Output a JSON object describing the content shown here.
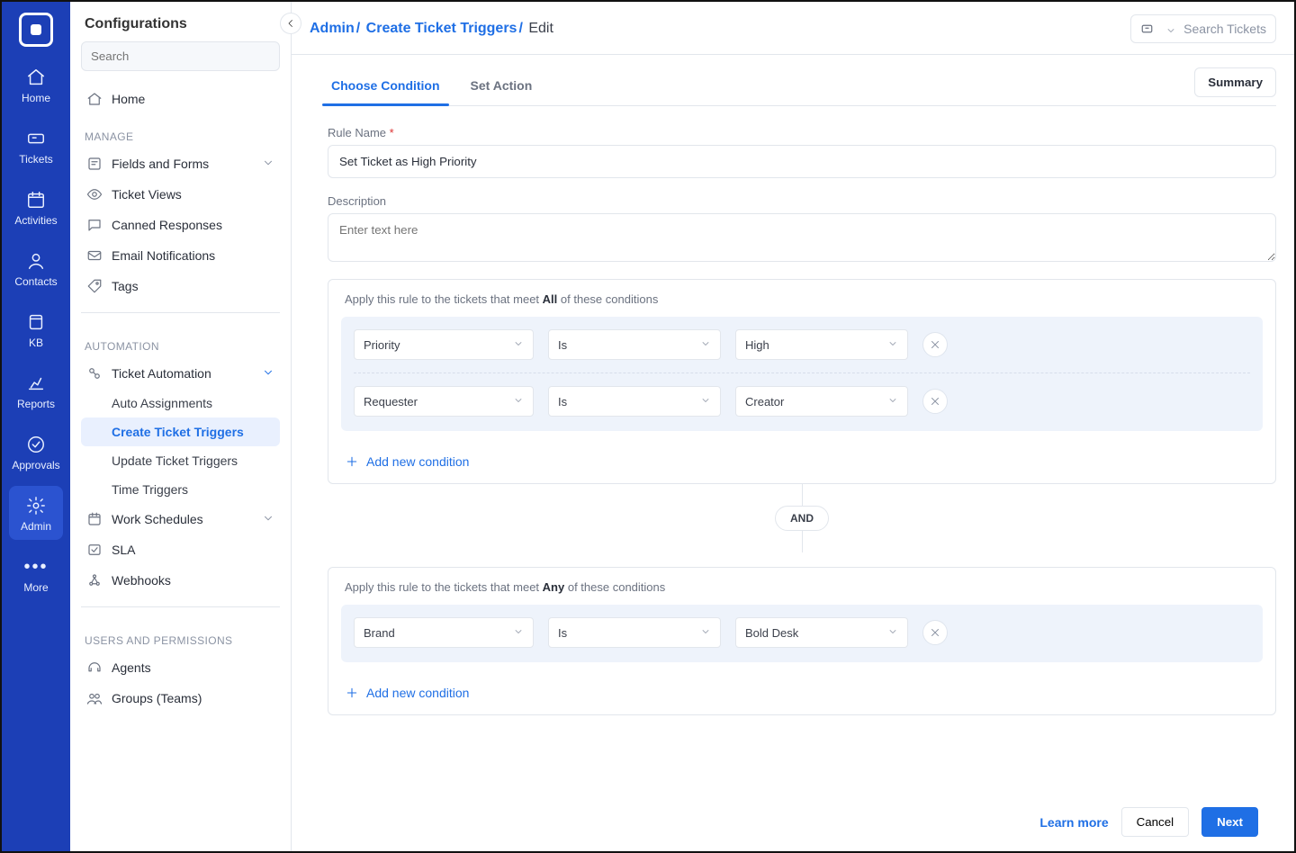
{
  "rail": {
    "items": [
      {
        "key": "home",
        "label": "Home"
      },
      {
        "key": "tickets",
        "label": "Tickets"
      },
      {
        "key": "activities",
        "label": "Activities"
      },
      {
        "key": "contacts",
        "label": "Contacts"
      },
      {
        "key": "kb",
        "label": "KB"
      },
      {
        "key": "reports",
        "label": "Reports"
      },
      {
        "key": "approvals",
        "label": "Approvals"
      },
      {
        "key": "admin",
        "label": "Admin",
        "active": true
      },
      {
        "key": "more",
        "label": "More"
      }
    ]
  },
  "side": {
    "title": "Configurations",
    "search_placeholder": "Search",
    "groups": {
      "manage": "MANAGE",
      "automation": "AUTOMATION",
      "users": "USERS AND PERMISSIONS"
    },
    "items": {
      "home": "Home",
      "fields_forms": "Fields and Forms",
      "ticket_views": "Ticket Views",
      "canned": "Canned Responses",
      "email_notifs": "Email Notifications",
      "tags": "Tags",
      "ticket_automation": "Ticket Automation",
      "auto_assign": "Auto Assignments",
      "create_triggers": "Create Ticket Triggers",
      "update_triggers": "Update Ticket Triggers",
      "time_triggers": "Time Triggers",
      "work_sched": "Work Schedules",
      "sla": "SLA",
      "webhooks": "Webhooks",
      "agents": "Agents",
      "groups_teams": "Groups (Teams)"
    }
  },
  "top": {
    "crumb1": "Admin",
    "crumb2": "Create Ticket Triggers",
    "crumb3": "Edit",
    "search_placeholder": "Search Tickets"
  },
  "tabs": {
    "choose": "Choose Condition",
    "set": "Set Action",
    "summary": "Summary"
  },
  "form": {
    "rule_name_label": "Rule Name",
    "rule_name_value": "Set Ticket as High Priority",
    "description_label": "Description",
    "description_placeholder": "Enter text here"
  },
  "cond": {
    "all_hint_prefix": "Apply this rule to the tickets that meet ",
    "all_word": "All",
    "any_word": "Any",
    "all_hint_suffix": " of these conditions",
    "rows_all": [
      {
        "field": "Priority",
        "op": "Is",
        "value": "High"
      },
      {
        "field": "Requester",
        "op": "Is",
        "value": "Creator"
      }
    ],
    "rows_any": [
      {
        "field": "Brand",
        "op": "Is",
        "value": "Bold Desk"
      }
    ],
    "add": "Add new condition",
    "and": "AND"
  },
  "footer": {
    "learn": "Learn more",
    "cancel": "Cancel",
    "next": "Next"
  }
}
